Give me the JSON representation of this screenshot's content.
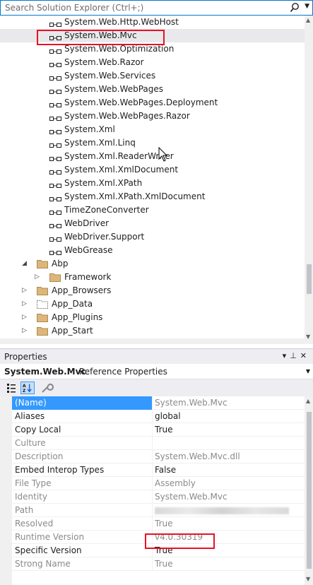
{
  "solution_explorer": {
    "search_placeholder": "Search Solution Explorer (Ctrl+;)",
    "references": [
      "System.Web.Http.WebHost",
      "System.Web.Mvc",
      "System.Web.Optimization",
      "System.Web.Razor",
      "System.Web.Services",
      "System.Web.WebPages",
      "System.Web.WebPages.Deployment",
      "System.Web.WebPages.Razor",
      "System.Xml",
      "System.Xml.Linq",
      "System.Xml.ReaderWriter",
      "System.Xml.XmlDocument",
      "System.Xml.XPath",
      "System.Xml.XPath.XmlDocument",
      "TimeZoneConverter",
      "WebDriver",
      "WebDriver.Support",
      "WebGrease"
    ],
    "folders": [
      {
        "label": "Abp",
        "expanded": true
      },
      {
        "label": "Framework",
        "expanded": false
      },
      {
        "label": "App_Browsers",
        "expanded": false
      },
      {
        "label": "App_Data",
        "expanded": false
      },
      {
        "label": "App_Plugins",
        "expanded": false
      },
      {
        "label": "App_Start",
        "expanded": false
      }
    ],
    "selected_item": "System.Web.Mvc"
  },
  "properties": {
    "title": "Properties",
    "object_name": "System.Web.Mvc",
    "object_kind": "Reference Properties",
    "rows": [
      {
        "name": "(Name)",
        "value": "System.Web.Mvc",
        "editable": false
      },
      {
        "name": "Aliases",
        "value": "global",
        "editable": true
      },
      {
        "name": "Copy Local",
        "value": "True",
        "editable": true
      },
      {
        "name": "Culture",
        "value": "",
        "editable": false
      },
      {
        "name": "Description",
        "value": "System.Web.Mvc.dll",
        "editable": false
      },
      {
        "name": "Embed Interop Types",
        "value": "False",
        "editable": true
      },
      {
        "name": "File Type",
        "value": "Assembly",
        "editable": false
      },
      {
        "name": "Identity",
        "value": "System.Web.Mvc",
        "editable": false
      },
      {
        "name": "Path",
        "value": "",
        "editable": false
      },
      {
        "name": "Resolved",
        "value": "True",
        "editable": false
      },
      {
        "name": "Runtime Version",
        "value": "v4.0.30319",
        "editable": false
      },
      {
        "name": "Specific Version",
        "value": "True",
        "editable": true
      },
      {
        "name": "Strong Name",
        "value": "True",
        "editable": false
      }
    ]
  },
  "colors": {
    "accent": "#007acc",
    "highlight_box": "#e81123",
    "selected_row": "#3399ff"
  }
}
